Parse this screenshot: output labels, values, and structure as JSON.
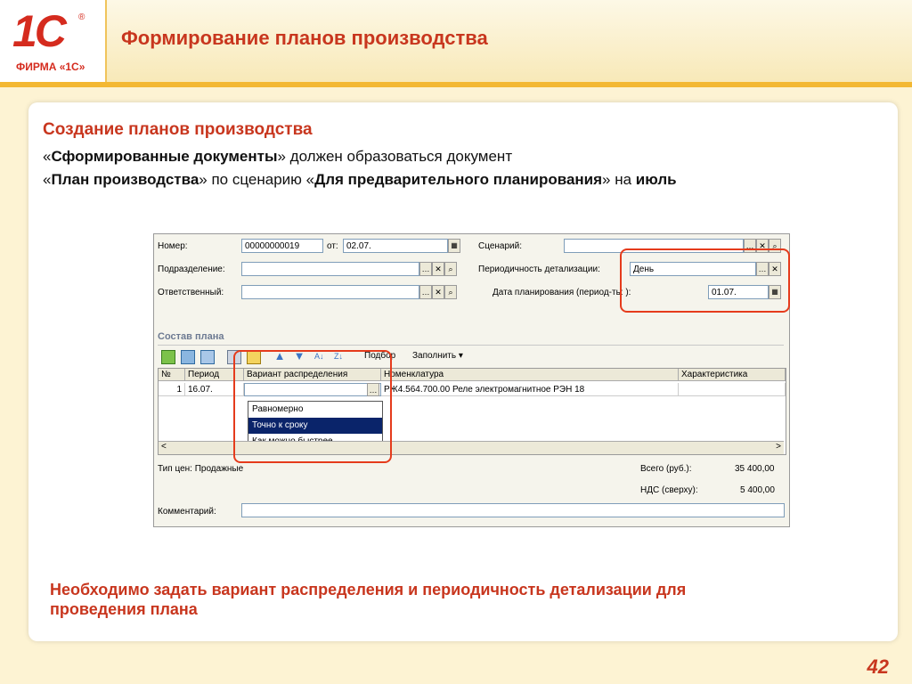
{
  "header": {
    "logo_text": "1С",
    "logo_firm": "ФИРМА «1С»",
    "title": "Формирование планов производства"
  },
  "card": {
    "subtitle": "Создание планов производства",
    "intro": {
      "q1_open": "«",
      "q1_bold": "Сформированные документы",
      "q1_rest": "» должен образоваться документ",
      "q2_open": "«",
      "q2_bold": "План производства",
      "q2_mid": "» по сценарию «",
      "q2_bold2": "Для предварительного планирования",
      "q2_mid2": "» на ",
      "q2_bold3": "июль"
    },
    "footer_note": "Необходимо задать вариант распределения и периодичность детализации для проведения плана",
    "page_number": "42"
  },
  "form": {
    "number_label": "Номер:",
    "number_value": "00000000019",
    "date_label": "от:",
    "date_value": "02.07.",
    "scenario_label": "Сценарий:",
    "scenario_value": "",
    "division_label": "Подразделение:",
    "period_label": "Периодичность детализации:",
    "period_value": "День",
    "responsible_label": "Ответственный:",
    "plan_date_label": "Дата планирования (период-ть: ):",
    "plan_date_value": "01.07.",
    "section_title": "Состав плана",
    "toolbar": {
      "pick": "Подбор",
      "fill": "Заполнить ▾"
    },
    "grid": {
      "headers": [
        "№",
        "Период",
        "Вариант распределения",
        "Номенклатура",
        "Характеристика"
      ],
      "row": {
        "num": "1",
        "period": "16.07.",
        "variant": "",
        "nomenclature": "РЖ4.564.700.00 Реле электромагнитное РЭН 18",
        "characteristic": ""
      }
    },
    "dropdown": [
      "Равномерно",
      "Точно к сроку",
      "Как можно быстрее"
    ],
    "dropdown_selected": "Точно к сроку",
    "price_type": "Тип цен: Продажные",
    "total_label": "Всего (руб.):",
    "total_value": "35 400,00",
    "vat_label": "НДС (сверху):",
    "vat_value": "5 400,00",
    "comment_label": "Комментарий:"
  },
  "colors": {
    "accent": "#c8361e",
    "highlight": "#e53b1c",
    "selection": "#0a246a"
  }
}
